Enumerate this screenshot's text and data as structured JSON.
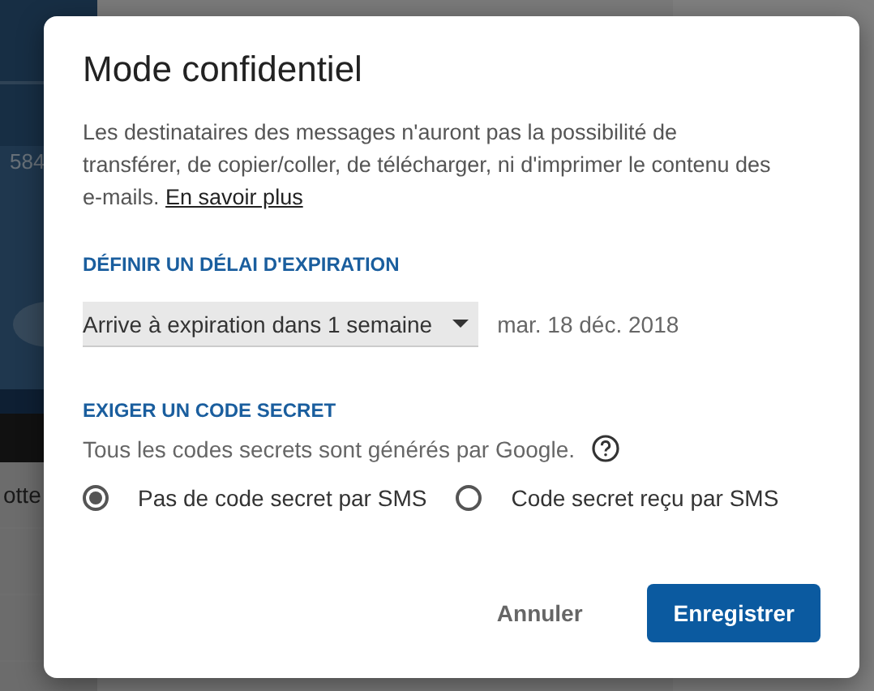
{
  "background": {
    "left": {
      "number": "584",
      "row_label": "otte"
    },
    "right": {
      "kind": "panel"
    }
  },
  "dialog": {
    "title": "Mode confidentiel",
    "description": "Les destinataires des messages n'auront pas la possibilité de transférer, de copier/coller, de télécharger, ni d'imprimer le contenu des e-mails.",
    "learn_more": "En savoir plus",
    "expiration": {
      "heading": "DÉFINIR UN DÉLAI D'EXPIRATION",
      "value": "Arrive à expiration dans 1 semaine",
      "date": "mar. 18 déc. 2018"
    },
    "passcode": {
      "heading": "EXIGER UN CODE SECRET",
      "note": "Tous les codes secrets sont générés par Google.",
      "options": [
        {
          "label": "Pas de code secret par SMS",
          "selected": true
        },
        {
          "label": "Code secret reçu par SMS",
          "selected": false
        }
      ]
    },
    "buttons": [
      {
        "label": "Annuler",
        "kind": "text"
      },
      {
        "label": "Enregistrer",
        "kind": "primary"
      }
    ]
  }
}
